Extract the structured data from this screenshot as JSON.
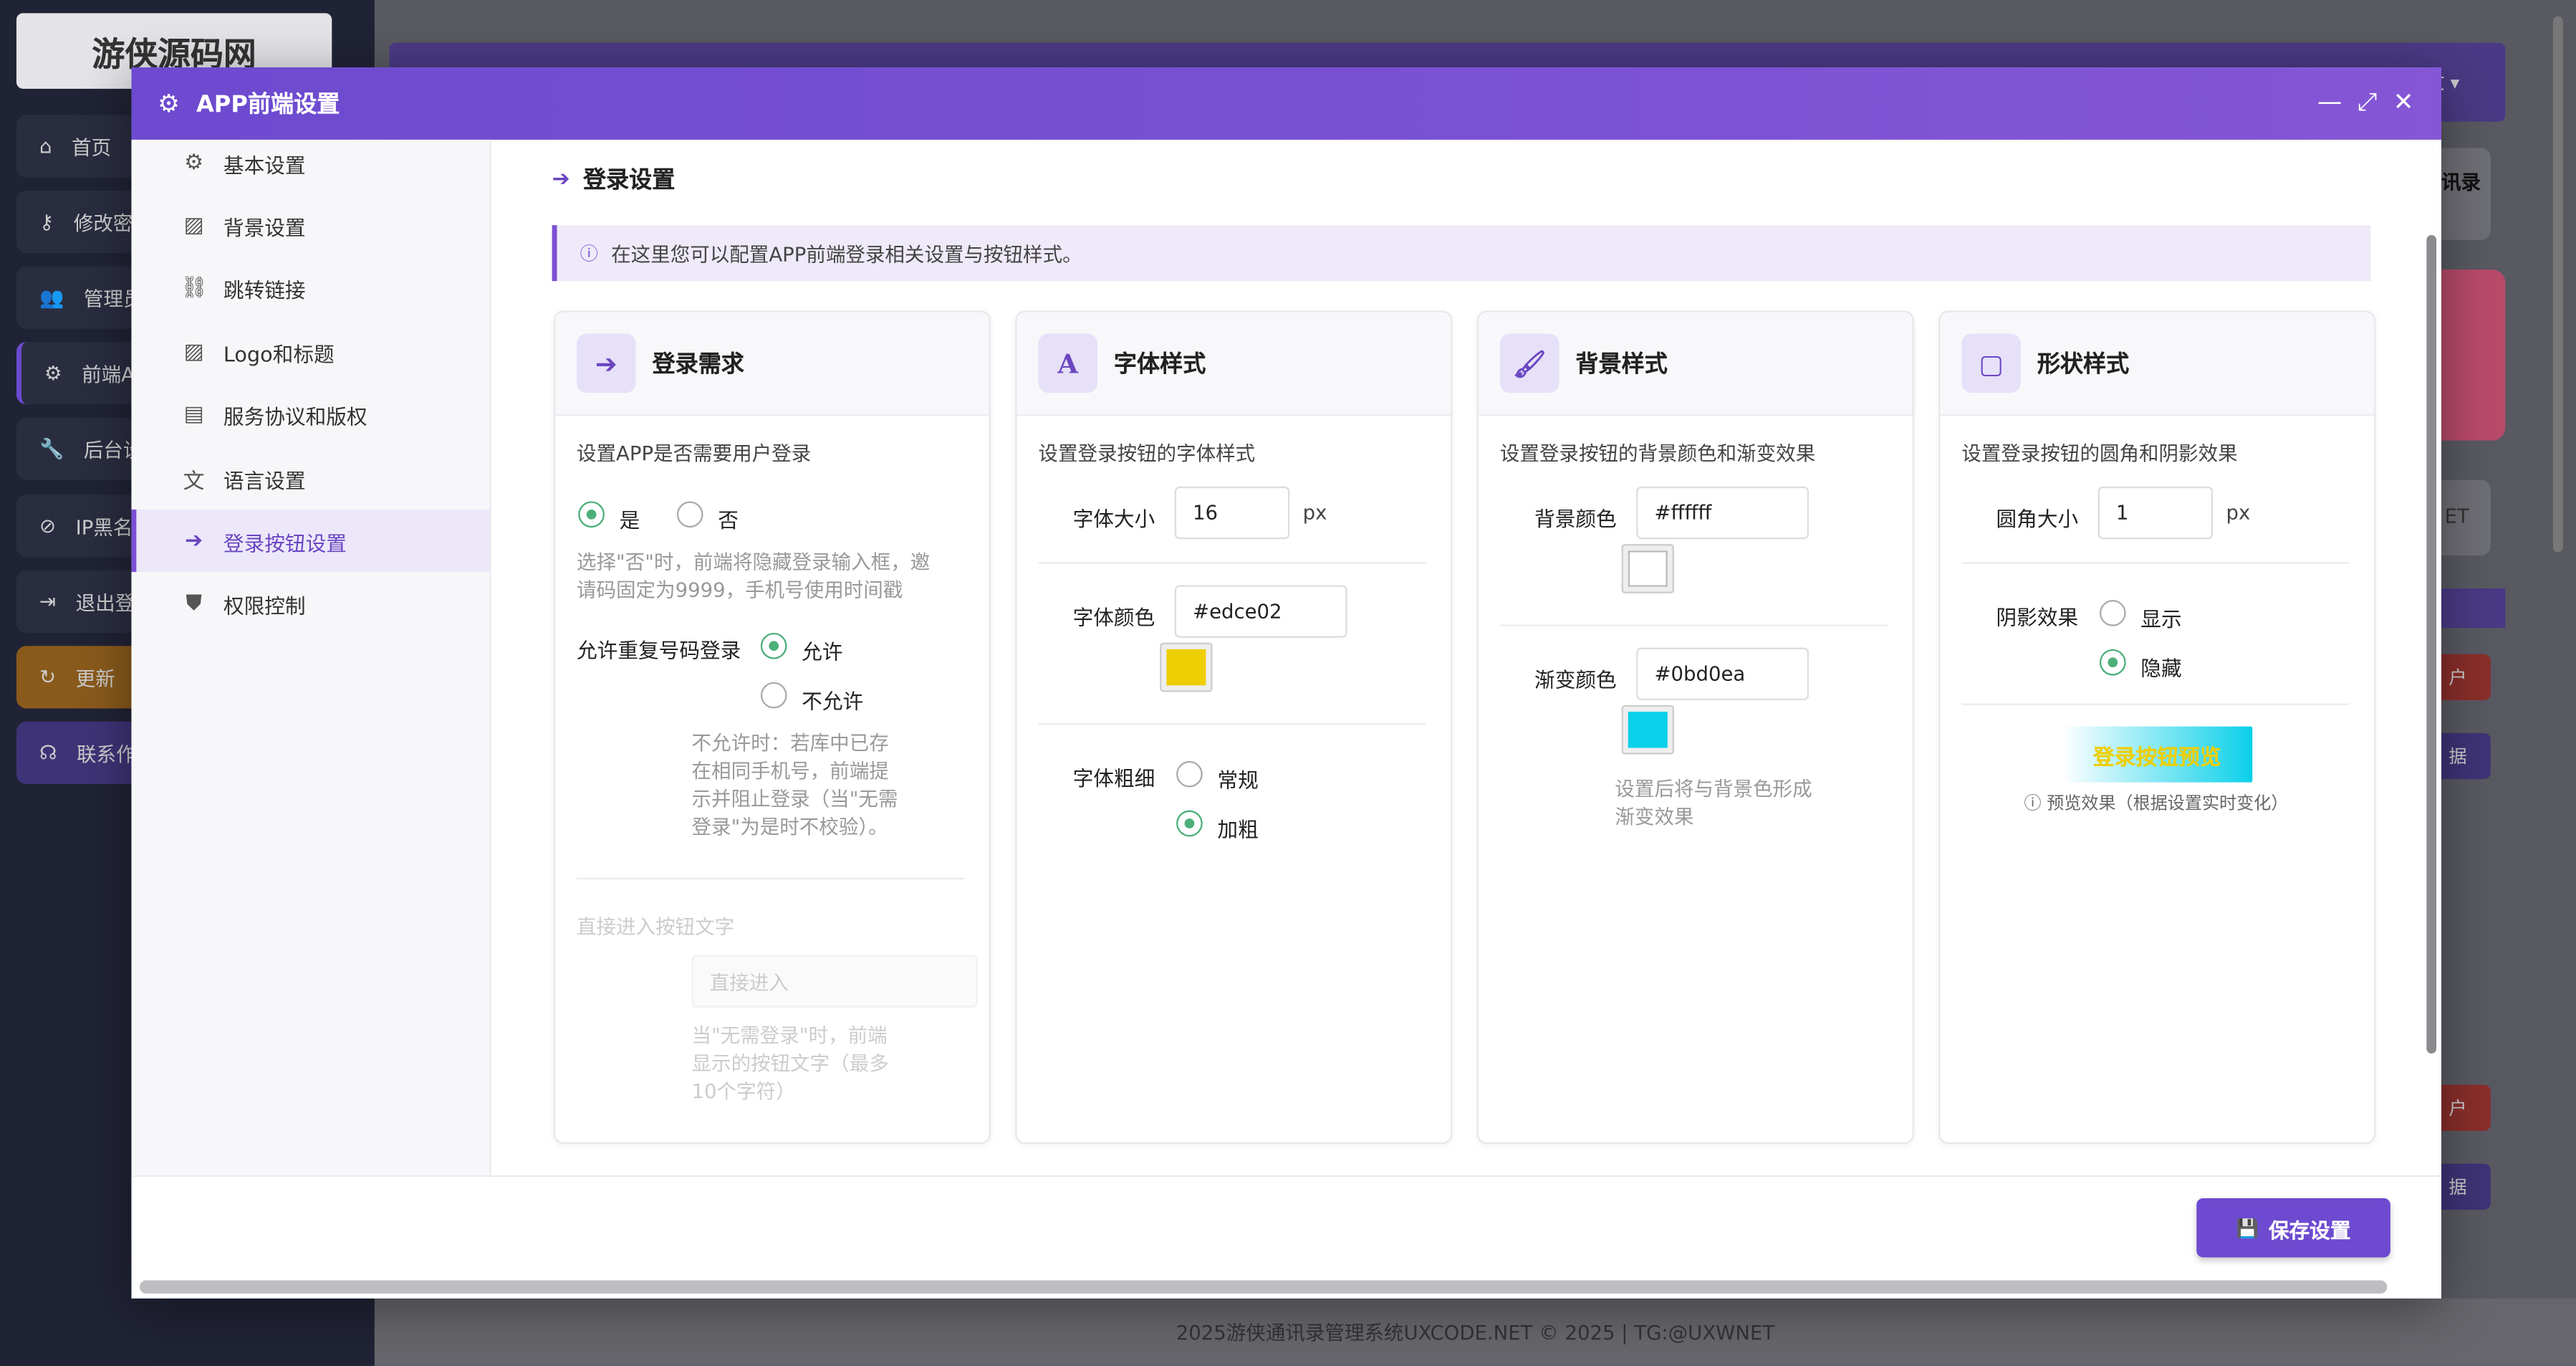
{
  "background": {
    "logo_text": "游侠源码网",
    "nav_items": [
      {
        "icon": "home-icon",
        "glyph": "⌂",
        "label": "首页"
      },
      {
        "icon": "key-icon",
        "glyph": "⚷",
        "label": "修改密"
      },
      {
        "icon": "users-icon",
        "glyph": "👥",
        "label": "管理员"
      },
      {
        "icon": "gear-icon",
        "glyph": "⚙",
        "label": "前端A"
      },
      {
        "icon": "wrench-icon",
        "glyph": "🔧",
        "label": "后台设"
      },
      {
        "icon": "ban-icon",
        "glyph": "⊘",
        "label": "IP黑名"
      },
      {
        "icon": "logout-icon",
        "glyph": "⇥",
        "label": "退出登"
      },
      {
        "icon": "refresh-icon",
        "glyph": "↻",
        "label": "更新"
      },
      {
        "icon": "headset-icon",
        "glyph": "☊",
        "label": "联系作"
      }
    ],
    "header_right": "文 ▾",
    "right_panel": {
      "title": "讯录",
      "label_et": "ET",
      "btn1": "户",
      "btn2": "据",
      "btn3": "户",
      "btn4": "据"
    },
    "footer": "2025游侠通讯录管理系统UXCODE.NET © 2025 | TG:@UXWNET"
  },
  "modal": {
    "title": "APP前端设置",
    "controls": {
      "minimize": "—",
      "maximize": "⤢",
      "close": "✕"
    },
    "nav": [
      {
        "icon": "gear-icon",
        "glyph": "⚙",
        "label": "基本设置"
      },
      {
        "icon": "image-icon",
        "glyph": "▨",
        "label": "背景设置"
      },
      {
        "icon": "link-icon",
        "glyph": "⛓",
        "label": "跳转链接"
      },
      {
        "icon": "image-icon",
        "glyph": "▨",
        "label": "Logo和标题"
      },
      {
        "icon": "file-icon",
        "glyph": "▤",
        "label": "服务协议和版权"
      },
      {
        "icon": "language-icon",
        "glyph": "文",
        "label": "语言设置"
      },
      {
        "icon": "login-icon",
        "glyph": "➔",
        "label": "登录按钮设置"
      },
      {
        "icon": "shield-icon",
        "glyph": "⛊",
        "label": "权限控制"
      }
    ],
    "active_nav": 6,
    "section_title": "登录设置",
    "alert": "在这里您可以配置APP前端登录相关设置与按钮样式。",
    "login_card": {
      "title": "登录需求",
      "desc": "设置APP是否需要用户登录",
      "opt_yes": "是",
      "opt_no": "否",
      "note_lines": [
        "选择\"否\"时，前端将隐藏登录输入框，邀",
        "请码固定为9999，手机号使用时间戳"
      ],
      "repeat_label": "允许重复号码登录",
      "allow": "允许",
      "disallow": "不允许",
      "repeat_note_lines": [
        "不允许时：若库中已存",
        "在相同手机号，前端提",
        "示并阻止登录（当\"无需",
        "登录\"为是时不校验）。"
      ],
      "direct_label": "直接进入按钮文字",
      "direct_placeholder": "直接进入",
      "direct_note_lines": [
        "当\"无需登录\"时，前端",
        "显示的按钮文字（最多",
        "10个字符）"
      ]
    },
    "font_card": {
      "title": "字体样式",
      "icon_glyph": "A",
      "desc": "设置登录按钮的字体样式",
      "size_label": "字体大小",
      "size_value": "16",
      "unit": "px",
      "color_label": "字体颜色",
      "color_value": "#edce02",
      "color_swatch": "#edce02",
      "weight_label": "字体粗细",
      "weight_normal": "常规",
      "weight_bold": "加粗"
    },
    "bg_card": {
      "title": "背景样式",
      "icon_glyph": "🖌",
      "desc": "设置登录按钮的背景颜色和渐变效果",
      "bg_label": "背景颜色",
      "bg_value": "#ffffff",
      "bg_swatch": "#ffffff",
      "grad_label": "渐变颜色",
      "grad_value": "#0bd0ea",
      "grad_swatch": "#0bd0ea",
      "note_lines": [
        "设置后将与背景色形成",
        "渐变效果"
      ]
    },
    "shape_card": {
      "title": "形状样式",
      "icon_glyph": "▢",
      "desc": "设置登录按钮的圆角和阴影效果",
      "radius_label": "圆角大小",
      "radius_value": "1",
      "unit": "px",
      "shadow_label": "阴影效果",
      "show": "显示",
      "hide": "隐藏",
      "preview_text": "登录按钮预览",
      "preview_note": "预览效果（根据设置实时变化）"
    },
    "save_label": "保存设置"
  },
  "colors": {
    "accent": "#6d4ad0",
    "radio_on": "#4caf79"
  }
}
